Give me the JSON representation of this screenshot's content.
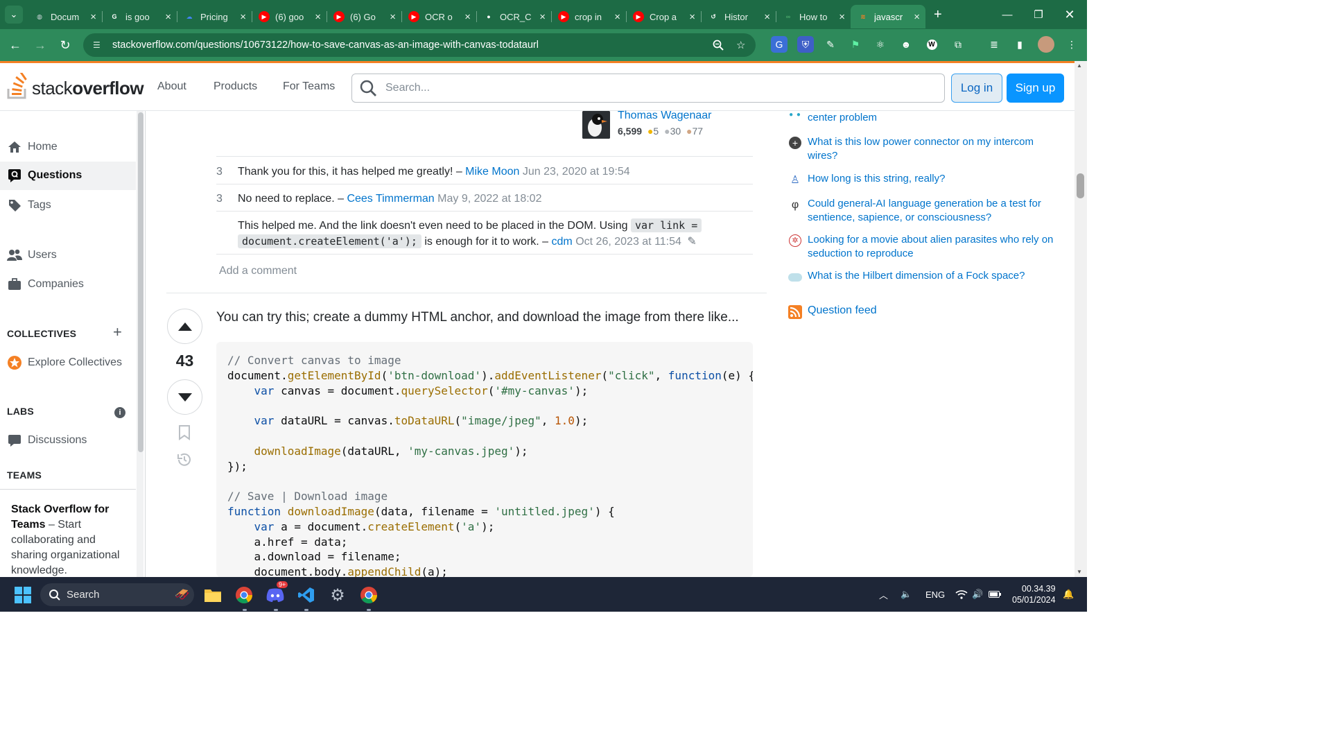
{
  "browser": {
    "tabs": [
      {
        "title": "Docum",
        "icon": "globe-icon",
        "color": "#cfd8dc"
      },
      {
        "title": "is goo",
        "icon": "google-icon",
        "color": "#ffffff"
      },
      {
        "title": "Pricing",
        "icon": "cloud-icon",
        "color": "#4285f4"
      },
      {
        "title": "(6) goo",
        "icon": "youtube-icon",
        "color": "#ff0000"
      },
      {
        "title": "(6) Go",
        "icon": "youtube-icon",
        "color": "#ff0000"
      },
      {
        "title": "OCR o",
        "icon": "youtube-icon",
        "color": "#ff0000"
      },
      {
        "title": "OCR_C",
        "icon": "github-icon",
        "color": "#ffffff"
      },
      {
        "title": "crop in",
        "icon": "youtube-icon",
        "color": "#ff0000"
      },
      {
        "title": "Crop a",
        "icon": "youtube-icon",
        "color": "#ff0000"
      },
      {
        "title": "Histor",
        "icon": "history-icon",
        "color": "#ffffff"
      },
      {
        "title": "How to",
        "icon": "sonar-icon",
        "color": "#49a66a"
      },
      {
        "title": "javascr",
        "icon": "stackoverflow-icon",
        "color": "#f48024",
        "active": true
      }
    ],
    "url": "stackoverflow.com/questions/10673122/how-to-save-canvas-as-an-image-with-canvas-todataurl"
  },
  "header": {
    "nav": [
      "About",
      "Products",
      "For Teams"
    ],
    "search_placeholder": "Search...",
    "login": "Log in",
    "signup": "Sign up"
  },
  "sidebar": {
    "home": "Home",
    "questions": "Questions",
    "tags": "Tags",
    "users": "Users",
    "companies": "Companies",
    "collectives_head": "COLLECTIVES",
    "explore": "Explore Collectives",
    "labs_head": "LABS",
    "discussions": "Discussions",
    "teams_head": "TEAMS",
    "teams_title": "Stack Overflow for Teams",
    "teams_body": " – Start collaborating and sharing organizational knowledge."
  },
  "user_card": {
    "name": "Thomas Wagenaar",
    "rep": "6,599",
    "gold": "5",
    "silver": "30",
    "bronze": "77"
  },
  "comments": [
    {
      "score": "3",
      "text": "Thank you for this, it has helped me greatly! – ",
      "user": "Mike Moon",
      "date": "Jun 23, 2020 at 19:54"
    },
    {
      "score": "3",
      "text": "No need to replace. – ",
      "user": "Cees Timmerman",
      "date": "May 9, 2022 at 18:02"
    },
    {
      "score": "",
      "text_a": "This helped me. And the link doesn't even need to be placed in the DOM. Using ",
      "code_a": "var link =",
      "code_b": "document.createElement('a');",
      "text_b": " is enough for it to work. – ",
      "user": "cdm",
      "date": "Oct 26, 2023 at 11:54"
    }
  ],
  "add_comment": "Add a comment",
  "answer": {
    "votes": "43",
    "text": "You can try this; create a dummy HTML anchor, and download the image from there like..."
  },
  "hot_questions": [
    {
      "title": "center problem",
      "icon": "dots-icon"
    },
    {
      "title": "What is this low power connector on my intercom wires?",
      "icon": "electronics-icon"
    },
    {
      "title": "How long is this string, really?",
      "icon": "puzzling-icon"
    },
    {
      "title": "Could general-AI language generation be a test for sentience, sapience, or consciousness?",
      "icon": "philosophy-icon"
    },
    {
      "title": "Looking for a movie about alien parasites who rely on seduction to reproduce",
      "icon": "scifi-icon"
    },
    {
      "title": "What is the Hilbert dimension of a Fock space?",
      "icon": "mathoverflow-icon"
    }
  ],
  "question_feed": "Question feed",
  "taskbar": {
    "search": "Search",
    "lang": "ENG",
    "time": "00.34.39",
    "date": "05/01/2024",
    "discord_badge": "9+"
  }
}
